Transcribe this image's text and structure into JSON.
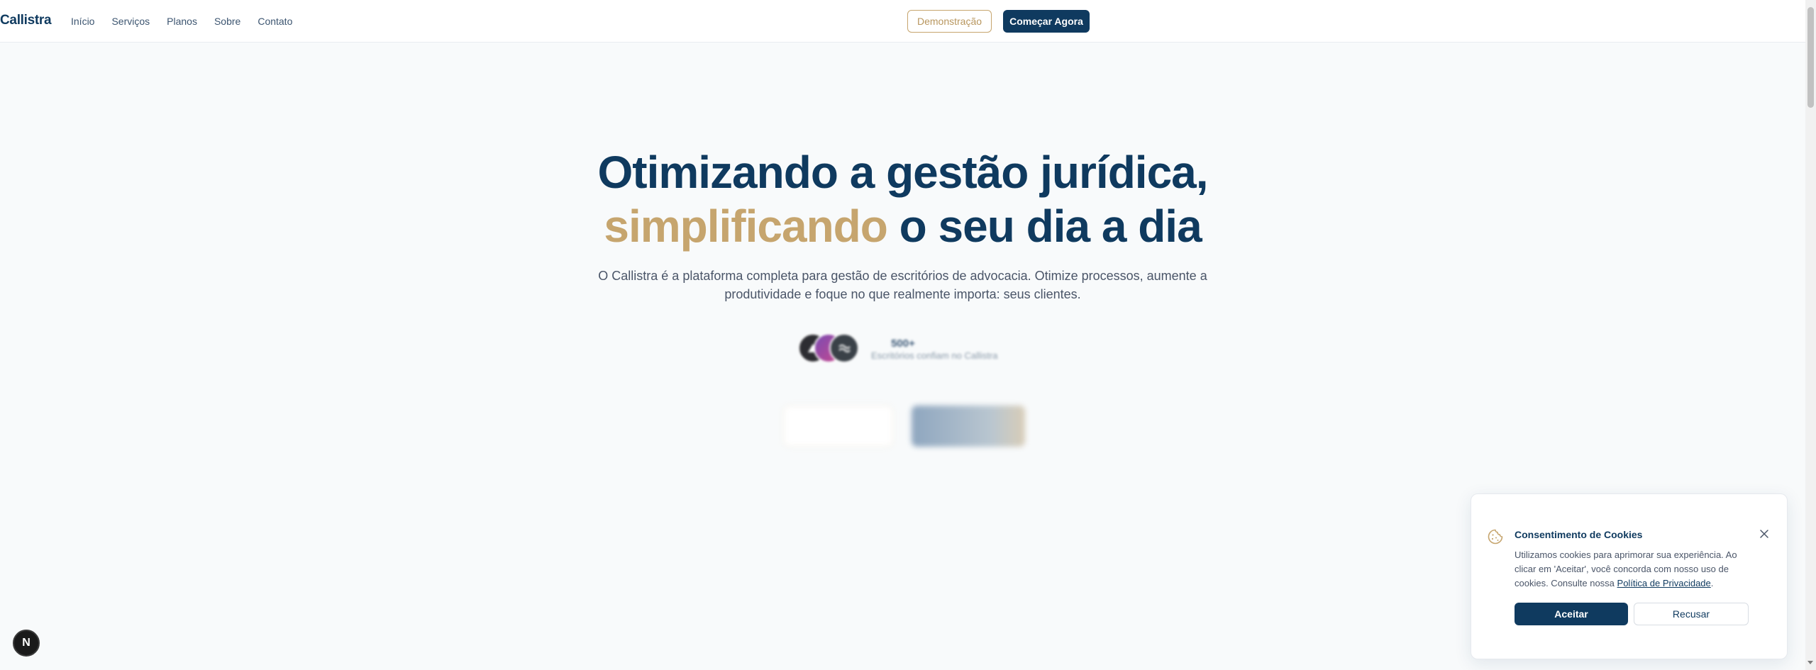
{
  "header": {
    "logo": "Callistra",
    "nav": [
      "Início",
      "Serviços",
      "Planos",
      "Sobre",
      "Contato"
    ],
    "demo_label": "Demonstração",
    "start_label": "Começar Agora"
  },
  "hero": {
    "title_line1": "Otimizando a gestão jurídica,",
    "title_highlight": "simplificando",
    "title_line2_rest": " o seu dia a dia",
    "subtitle": "O Callistra é a plataforma completa para gestão de escritórios de advocacia. Otimize processos, aumente a produtividade e foque no que realmente importa: seus clientes.",
    "trust_count": "500+",
    "trust_text": "Escritórios confiam no Callistra"
  },
  "cookie": {
    "title": "Consentimento de Cookies",
    "body": "Utilizamos cookies para aprimorar sua experiência. Ao clicar em 'Aceitar', você concorda com nosso uso de cookies. Consulte nossa ",
    "link": "Política de Privacidade",
    "body_end": ".",
    "accept_label": "Aceitar",
    "reject_label": "Recusar"
  },
  "next_badge": "N",
  "colors": {
    "primary": "#0f3a5f",
    "accent": "#c6a56e"
  }
}
